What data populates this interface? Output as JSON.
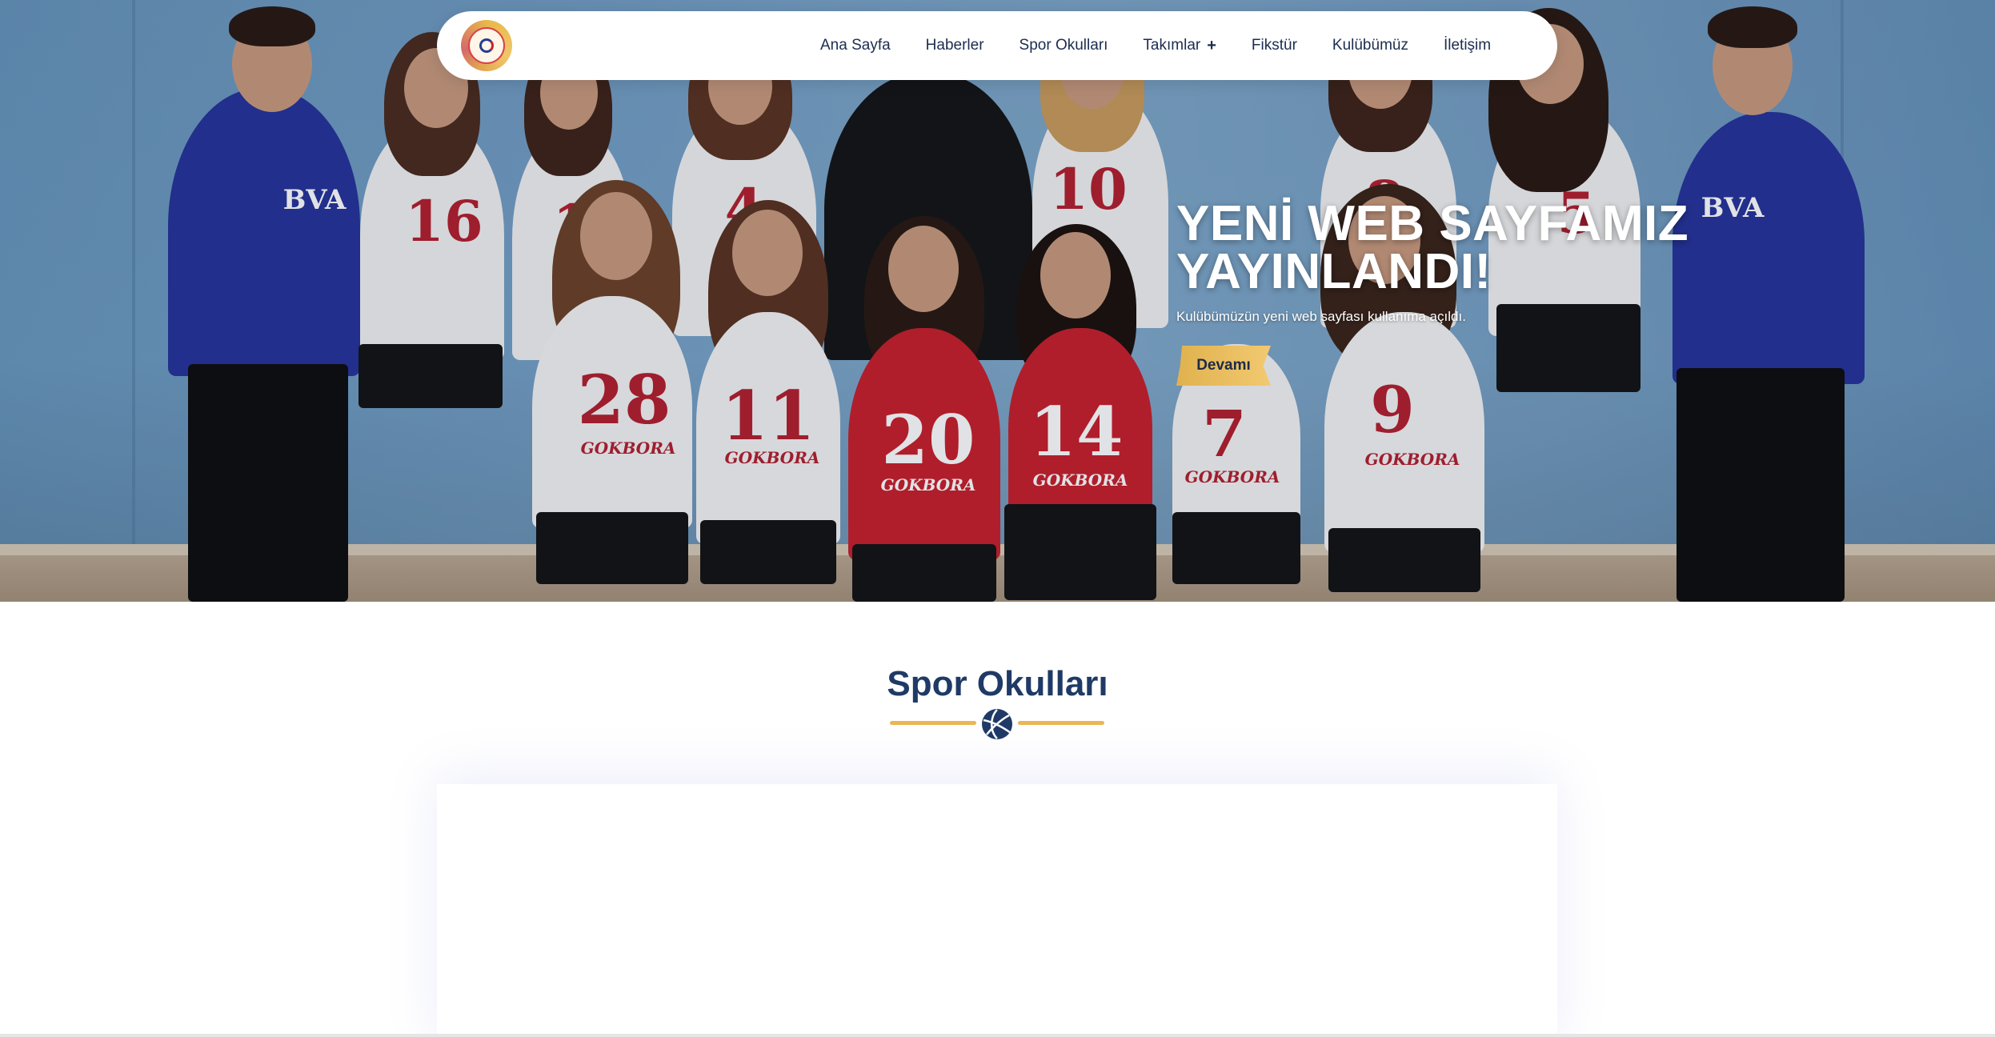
{
  "nav": {
    "items": [
      {
        "label": "Ana Sayfa"
      },
      {
        "label": "Haberler"
      },
      {
        "label": "Spor Okulları"
      },
      {
        "label": "Takımlar",
        "expand_symbol": "+"
      },
      {
        "label": "Fikstür"
      },
      {
        "label": "Kulübümüz"
      },
      {
        "label": "İletişim"
      }
    ]
  },
  "hero": {
    "title_line1": "YENİ WEB SAYFAMIZ",
    "title_line2": "YAYINLANDI!",
    "subtitle": "Kulübümüzün yeni web sayfası kullanıma açıldı.",
    "button_label": "Devamı",
    "photo_text": {
      "jersey_numbers_back": [
        "16",
        "1",
        "4",
        "10",
        "8",
        "5"
      ],
      "jersey_numbers_front": [
        "28",
        "11",
        "20",
        "14",
        "7",
        "9"
      ],
      "staff_shirt_text": "BVA",
      "jersey_sponsor": "GOKBORA"
    }
  },
  "section": {
    "title": "Spor Okulları"
  },
  "colors": {
    "nav_text": "#1b2d4f",
    "section_title": "#1f3a66",
    "accent_gold": "#eab656"
  }
}
